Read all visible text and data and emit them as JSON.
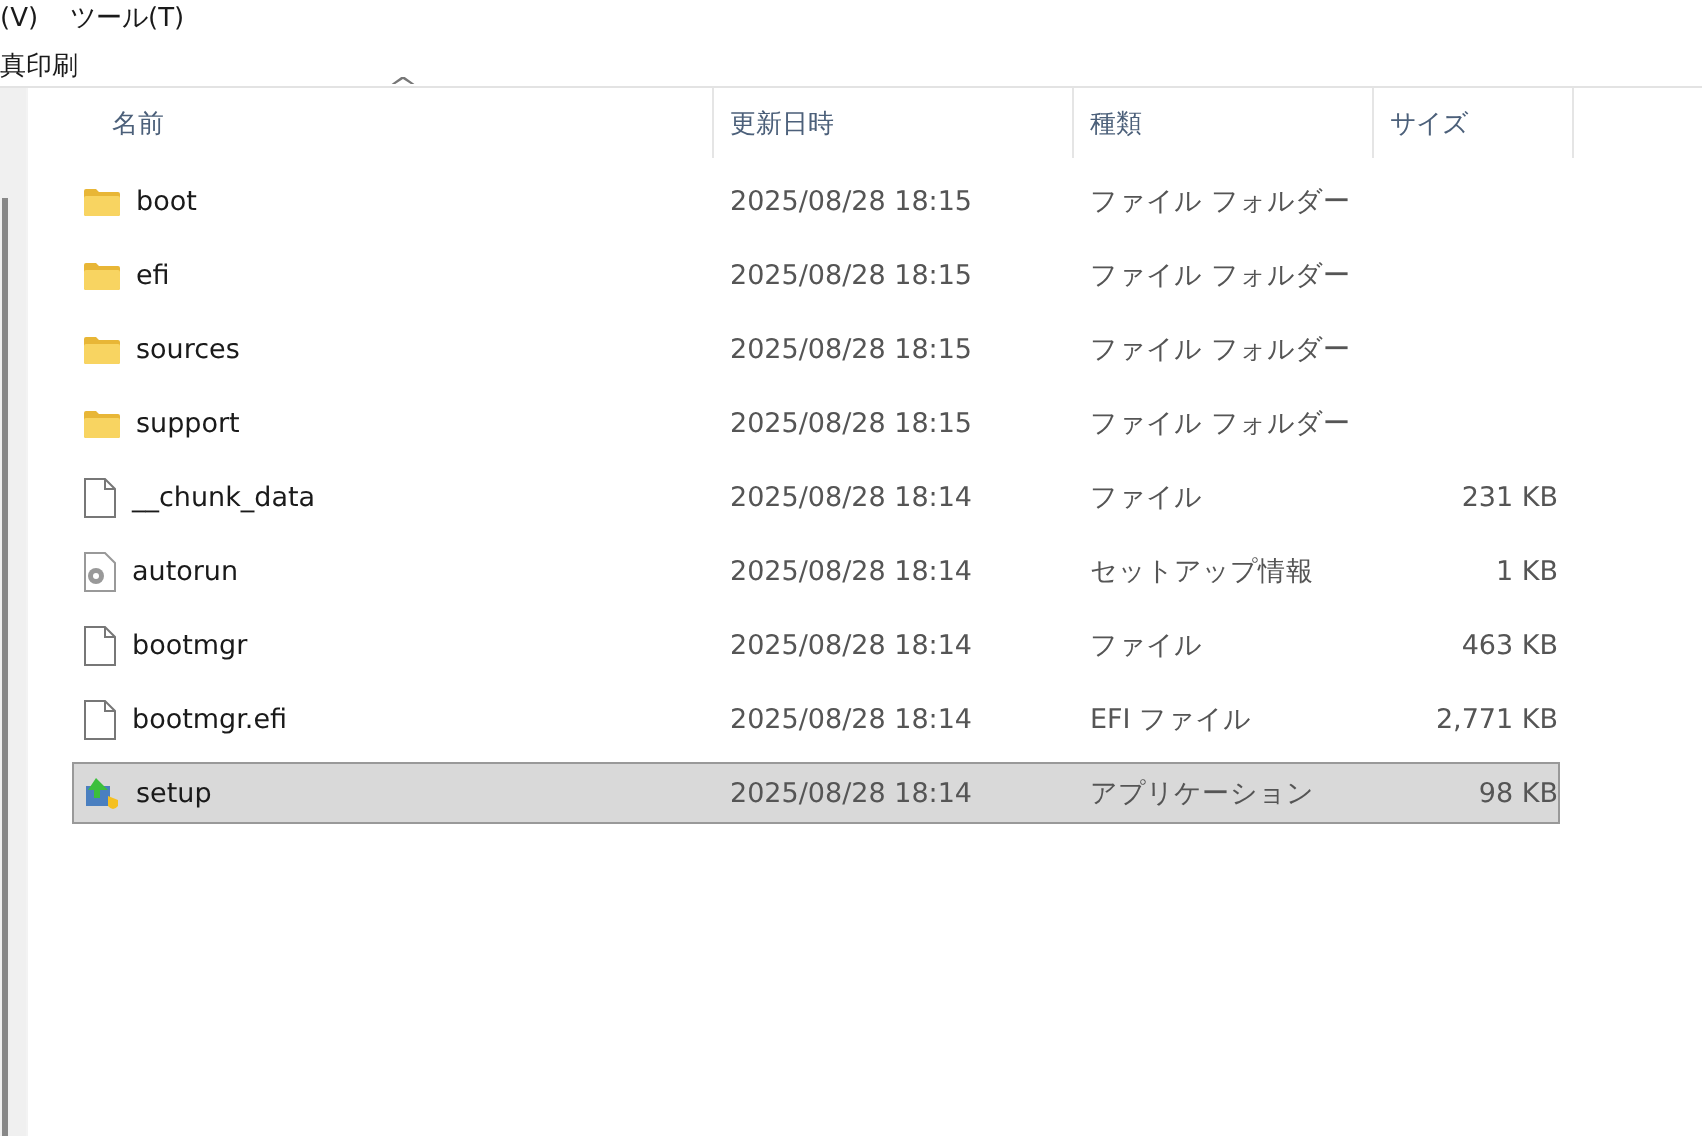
{
  "menu_bar": [
    "(V)",
    "ツール(T)"
  ],
  "toolbar": {
    "label": "真印刷"
  },
  "table": {
    "sort_indicator": "^",
    "columns": [
      "名前",
      "更新日時",
      "種類",
      "サイズ"
    ],
    "rows": [
      {
        "kind": "folder",
        "name": "boot",
        "modified": "2025/08/28 18:15",
        "type": "ファイル フォルダー",
        "selected": false
      },
      {
        "kind": "folder",
        "name": "efi",
        "modified": "2025/08/28 18:15",
        "type": "ファイル フォルダー",
        "selected": false
      },
      {
        "kind": "folder",
        "name": "sources",
        "modified": "2025/08/28 18:15",
        "type": "ファイル フォルダー",
        "selected": false
      },
      {
        "kind": "folder",
        "name": "support",
        "modified": "2025/08/28 18:15",
        "type": "ファイル フォルダー",
        "selected": false
      },
      {
        "kind": "file",
        "name": "__chunk_data",
        "modified": "2025/08/28 18:14",
        "type": "ファイル",
        "size": "231 KB",
        "selected": false
      },
      {
        "kind": "settings",
        "name": "autorun",
        "modified": "2025/08/28 18:14",
        "type": "セットアップ情報",
        "size": "1 KB",
        "selected": false
      },
      {
        "kind": "file",
        "name": "bootmgr",
        "modified": "2025/08/28 18:14",
        "type": "ファイル",
        "size": "463 KB",
        "selected": false
      },
      {
        "kind": "file",
        "name": "bootmgr.efi",
        "modified": "2025/08/28 18:14",
        "type": "EFI ファイル",
        "size": "2,771 KB",
        "selected": false
      },
      {
        "kind": "installer",
        "name": "setup",
        "modified": "2025/08/28 18:14",
        "type": "アプリケーション",
        "size": "98 KB",
        "selected": true
      }
    ]
  }
}
